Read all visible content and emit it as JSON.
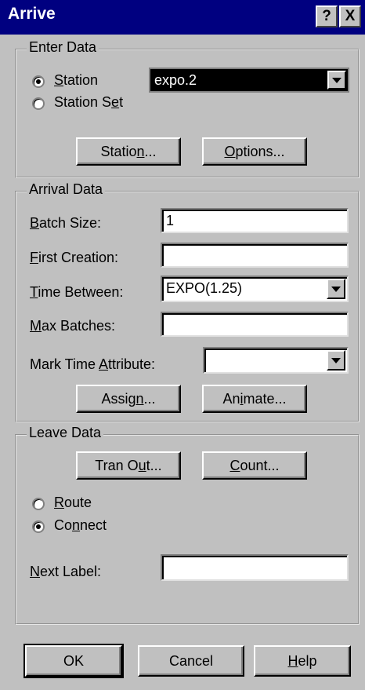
{
  "window": {
    "title": "Arrive",
    "help_button": "?",
    "close_button": "X"
  },
  "enter_data": {
    "group_title": "Enter Data",
    "radio_station": {
      "prefix": "",
      "mnemonic": "S",
      "rest": "tation",
      "selected": true
    },
    "radio_station_set": {
      "prefix": "Station S",
      "mnemonic": "e",
      "rest": "t",
      "selected": false
    },
    "station_combo_value": "expo.2",
    "station_button": {
      "prefix": "Statio",
      "mnemonic": "n",
      "rest": "..."
    },
    "options_button": {
      "prefix": "",
      "mnemonic": "O",
      "rest": "ptions..."
    }
  },
  "arrival_data": {
    "group_title": "Arrival Data",
    "batch_size": {
      "label_mnemonic": "B",
      "label_rest": "atch Size:",
      "value": "1"
    },
    "first_creation": {
      "label_mnemonic": "F",
      "label_rest": "irst Creation:",
      "value": ""
    },
    "time_between": {
      "label_mnemonic": "T",
      "label_rest": "ime Between:",
      "value": "EXPO(1.25)"
    },
    "max_batches": {
      "label_prefix": "",
      "label_mnemonic": "M",
      "label_rest": "ax Batches:",
      "value": ""
    },
    "mark_time": {
      "label_prefix": "Mark Time ",
      "label_mnemonic": "A",
      "label_rest": "ttribute:",
      "value": ""
    },
    "assign_button": {
      "prefix": "Assig",
      "mnemonic": "n",
      "rest": "..."
    },
    "animate_button": {
      "prefix": "An",
      "mnemonic": "i",
      "rest": "mate..."
    }
  },
  "leave_data": {
    "group_title": "Leave Data",
    "tran_out_button": {
      "prefix": "Tran O",
      "mnemonic": "u",
      "rest": "t..."
    },
    "count_button": {
      "prefix": "",
      "mnemonic": "C",
      "rest": "ount..."
    },
    "radio_route": {
      "prefix": "",
      "mnemonic": "R",
      "rest": "oute",
      "selected": false
    },
    "radio_connect": {
      "prefix": "Co",
      "mnemonic": "n",
      "rest": "nect",
      "selected": true
    },
    "next_label": {
      "label_mnemonic": "N",
      "label_rest": "ext Label:",
      "value": ""
    }
  },
  "footer": {
    "ok": "OK",
    "cancel": "Cancel",
    "help": {
      "mnemonic": "H",
      "rest": "elp"
    }
  }
}
